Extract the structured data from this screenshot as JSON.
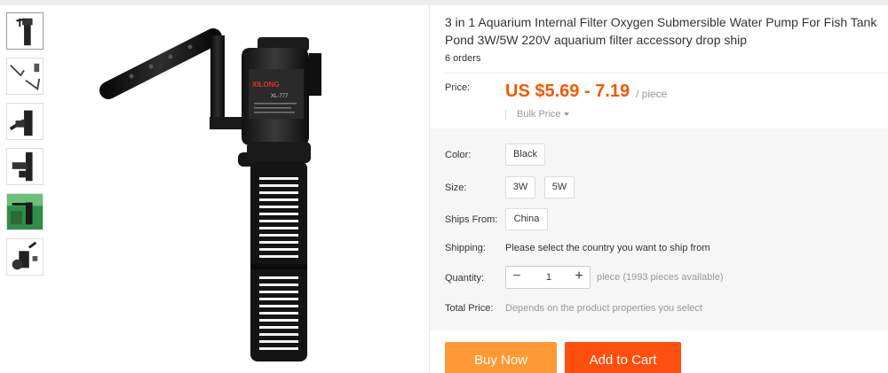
{
  "product": {
    "title": "3 in 1 Aquarium Internal Filter Oxygen Submersible Water Pump For Fish Tank Pond 3W/5W 220V aquarium filter accessory drop ship",
    "orders": "6 orders",
    "image_alt": "aquarium-internal-filter-pump",
    "brand_on_image": "XILONG",
    "model_on_image": "XL-777",
    "thumbnails": [
      "pump-front",
      "pump-parts",
      "pump-side",
      "pump-nozzle",
      "pump-in-tank",
      "pump-detail"
    ]
  },
  "price": {
    "label": "Price:",
    "value": "US $5.69 - 7.19",
    "unit": "/ piece",
    "bulk_label": "Bulk Price",
    "accent_color": "#f25900"
  },
  "options": {
    "color": {
      "label": "Color:",
      "values": [
        "Black"
      ]
    },
    "size": {
      "label": "Size:",
      "values": [
        "3W",
        "5W"
      ]
    },
    "ships_from": {
      "label": "Ships From:",
      "values": [
        "China"
      ]
    }
  },
  "shipping": {
    "label": "Shipping:",
    "text": "Please select the country you want to ship from"
  },
  "quantity": {
    "label": "Quantity:",
    "value": "1",
    "minus": "−",
    "plus": "+",
    "note": "piece (1993 pieces available)"
  },
  "total": {
    "label": "Total Price:",
    "text": "Depends on the product properties you select"
  },
  "actions": {
    "buy_now": "Buy Now",
    "add_to_cart": "Add to Cart",
    "buy_color": "#ff9933",
    "cart_color": "#ff4f0e"
  }
}
